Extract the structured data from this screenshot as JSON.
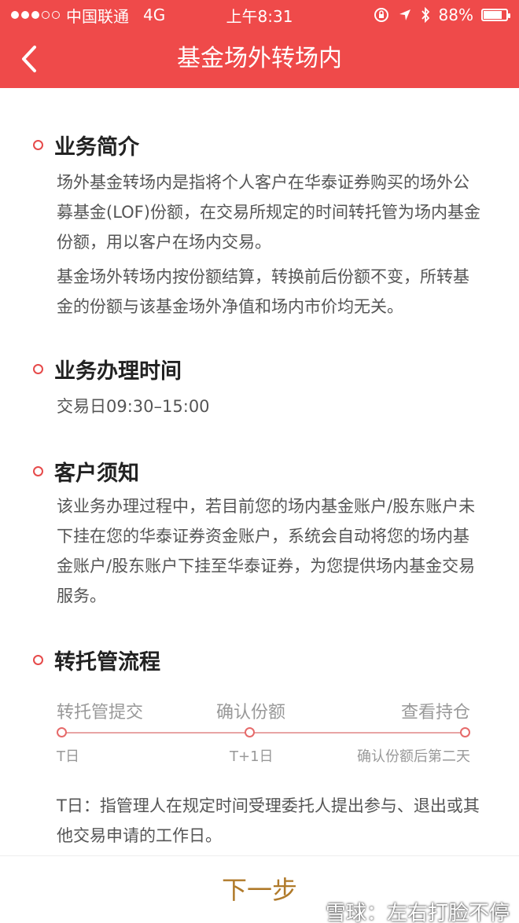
{
  "status_bar": {
    "carrier": "中国联通",
    "network": "4G",
    "time": "上午8:31",
    "battery": "88%",
    "battery_level": 0.88
  },
  "nav": {
    "title": "基金场外转场内"
  },
  "sections": {
    "intro": {
      "title": "业务简介",
      "para1": "场外基金转场内是指将个人客户在华泰证券购买的场外公募基金(LOF)份额，在交易所规定的时间转托管为场内基金份额，用以客户在场内交易。",
      "para2": "基金场外转场内按份额结算，转换前后份额不变，所转基金的份额与该基金场外净值和场内市价均无关。"
    },
    "hours": {
      "title": "业务办理时间",
      "text": "交易日09:30–15:00"
    },
    "notice": {
      "title": "客户须知",
      "text": "该业务办理过程中，若目前您的场内基金账户/股东账户未下挂在您的华泰证券资金账户，系统会自动将您的场内基金账户/股东账户下挂至华泰证券，为您提供场内基金交易服务。"
    },
    "flow": {
      "title": "转托管流程",
      "steps": [
        {
          "label": "转托管提交",
          "day": "T日"
        },
        {
          "label": "确认份额",
          "day": "T+1日"
        },
        {
          "label": "查看持仓",
          "day": "确认份额后第二天"
        }
      ],
      "note": "T日：指管理人在规定时间受理委托人提出参与、退出或其他交易申请的工作日。"
    }
  },
  "footer": {
    "next_label": "下一步",
    "watermark": "雪球：左右打脸不停"
  },
  "colors": {
    "brand_red": "#ef4a4a",
    "accent_gold": "#b07a2a"
  }
}
